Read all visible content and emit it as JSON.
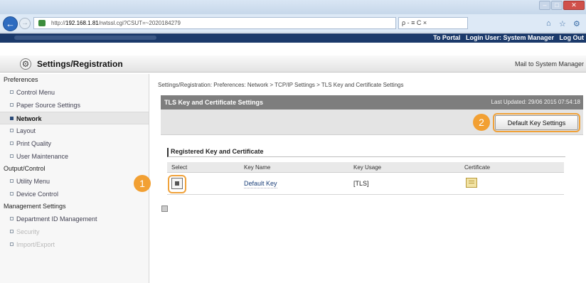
{
  "browser": {
    "url_prefix": "http://",
    "url_host": "192.168.1.81",
    "url_path": "/rwtssl.cgi?CSUT=~2020184279",
    "search_text": "ρ - ≡ C ×",
    "window_min": "–",
    "window_max": "□",
    "window_close": "✕",
    "back_glyph": "←",
    "forward_glyph": "→",
    "home_glyph": "⌂",
    "favorites_glyph": "☆",
    "settings_glyph": "⚙"
  },
  "header": {
    "to_portal": "To Portal",
    "login_user": "Login User: System Manager",
    "log_out": "Log Out",
    "page_title": "Settings/Registration",
    "mail_link": "Mail to System Manager",
    "gear_glyph": "⚙"
  },
  "sidebar": {
    "groups": [
      {
        "label": "Preferences",
        "items": [
          {
            "label": "Control Menu",
            "active": false
          },
          {
            "label": "Paper Source Settings",
            "active": false
          },
          {
            "label": "Network",
            "active": true
          },
          {
            "label": "Layout",
            "active": false
          },
          {
            "label": "Print Quality",
            "active": false
          },
          {
            "label": "User Maintenance",
            "active": false
          }
        ]
      },
      {
        "label": "Output/Control",
        "items": [
          {
            "label": "Utility Menu",
            "active": false
          },
          {
            "label": "Device Control",
            "active": false
          }
        ]
      },
      {
        "label": "Management Settings",
        "items": [
          {
            "label": "Department ID Management",
            "active": false
          },
          {
            "label": "Security",
            "active": false
          },
          {
            "label": "Import/Export",
            "active": false
          }
        ]
      }
    ]
  },
  "main": {
    "breadcrumb": "Settings/Registration: Preferences: Network > TCP/IP Settings > TLS Key and Certificate Settings",
    "panel_title": "TLS Key and Certificate Settings",
    "last_updated": "Last Updated: 29/06 2015 07:54:18",
    "default_key_button": "Default Key Settings",
    "section_title": "Registered Key and Certificate",
    "columns": [
      "Select",
      "Key Name",
      "Key Usage",
      "Certificate"
    ],
    "rows": [
      {
        "key_name": "Default Key",
        "key_usage": "[TLS]"
      }
    ],
    "callouts": [
      "1",
      "2"
    ]
  },
  "colors": {
    "callout": "#f2a033",
    "topbar": "#1b3a6b",
    "panel_header": "#7e7e7e"
  }
}
